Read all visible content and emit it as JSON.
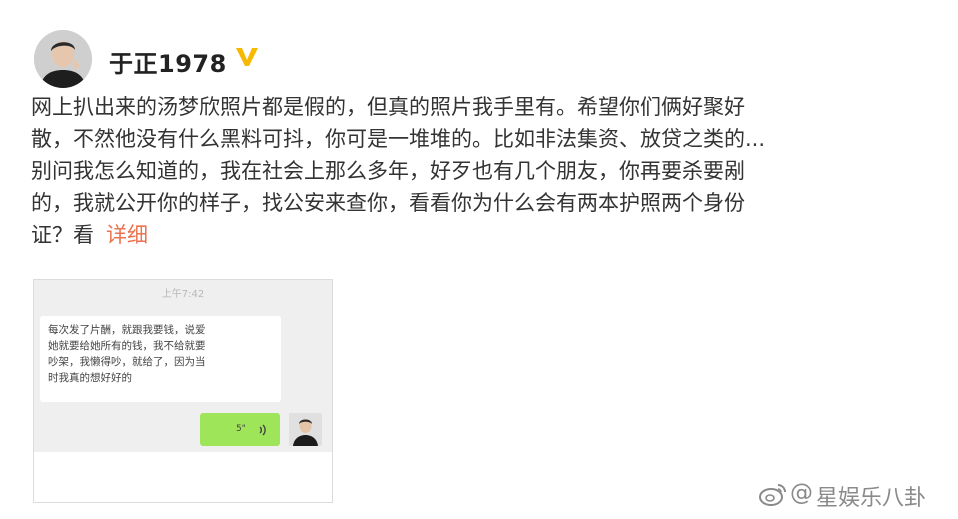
{
  "post": {
    "username": "于正1978",
    "content_lines": [
      "网上扒出来的汤梦欣照片都是假的，但真的照片我手里有。希望你们俩好聚好",
      "散，不然他没有什么黑料可抖，你可是一堆堆的。比如非法集资、放贷之类的...",
      "别问我怎么知道的，我在社会上那么多年，好歹也有几个朋友，你再要杀要剐",
      "的，我就公开你的样子，找公安来查你，看看你为什么会有两本护照两个身份",
      "证？看"
    ],
    "more_link": "详细"
  },
  "chat_image": {
    "time": "上午7:42",
    "message_lines": [
      "每次发了片酬，就跟我要钱，说爱",
      "她就要给她所有的钱，我不给就要",
      "吵架，我懒得吵，就给了，因为当",
      "时我真的想好好的"
    ],
    "voice_duration": "5\"",
    "voice_icon": "🔊"
  },
  "watermark": {
    "at": "@",
    "name": "星娱乐八卦"
  },
  "colors": {
    "link": "#eb7350",
    "verified": "#f6b900",
    "bubble_green": "#9fe55a"
  },
  "icons": [
    "avatar",
    "verified-icon",
    "voice-icon",
    "weibo-logo-icon"
  ]
}
